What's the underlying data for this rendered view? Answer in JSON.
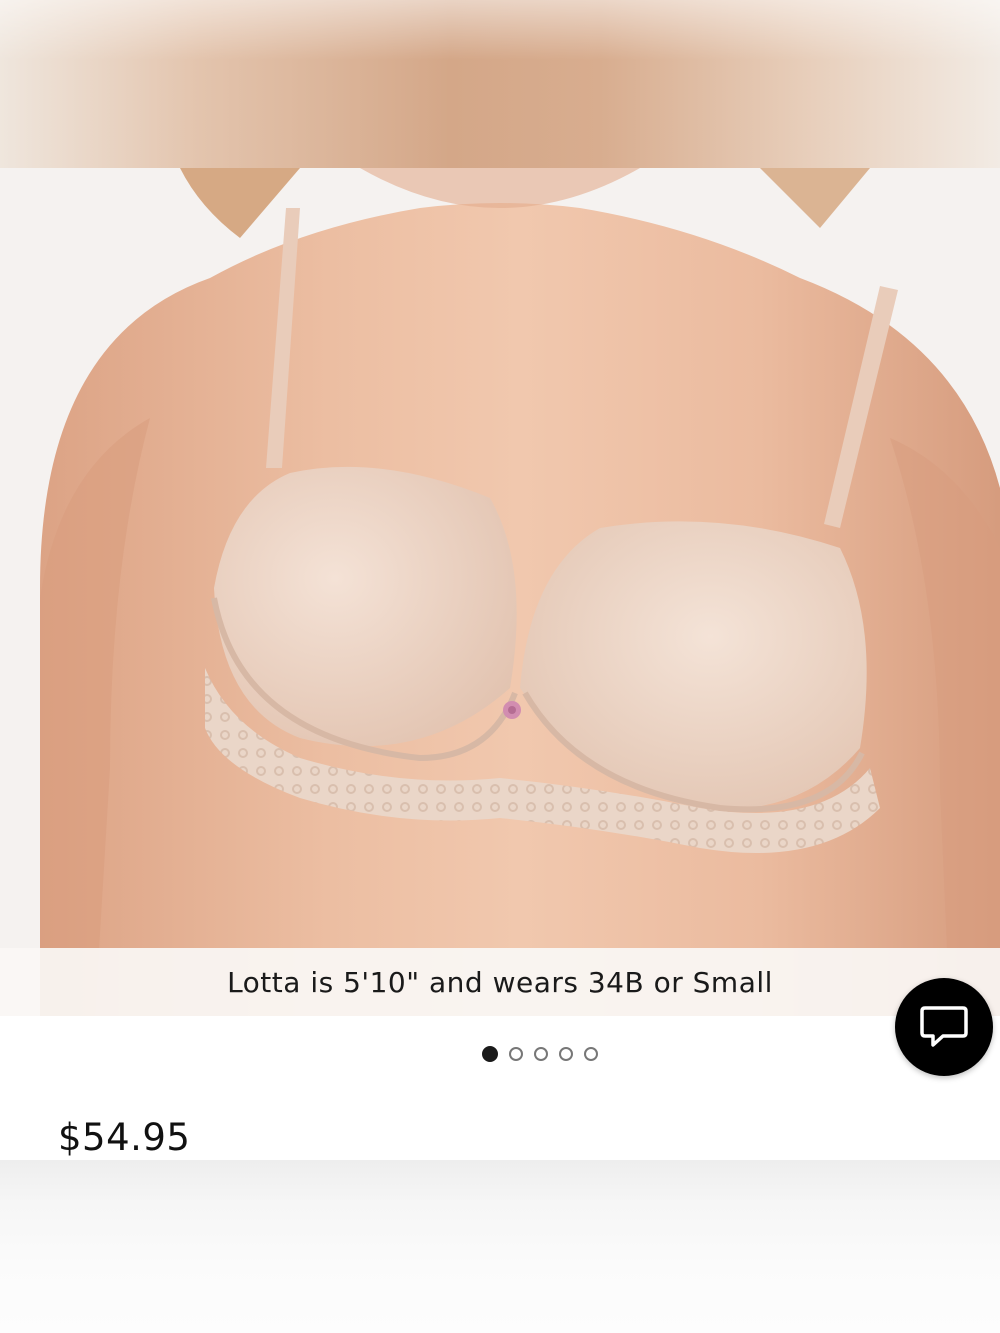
{
  "product": {
    "model_caption": "Lotta is 5'10\" and wears 34B or Small",
    "price": "$54.95",
    "image_alt": "product-photo"
  },
  "carousel": {
    "active_index": 0,
    "count": 5
  },
  "chat": {
    "icon": "chat-bubble-icon"
  },
  "colors": {
    "skin": "#e8b597",
    "bra": "#ecd3c2",
    "lace": "#e7d2c3",
    "accent_rose": "#d28db0"
  }
}
